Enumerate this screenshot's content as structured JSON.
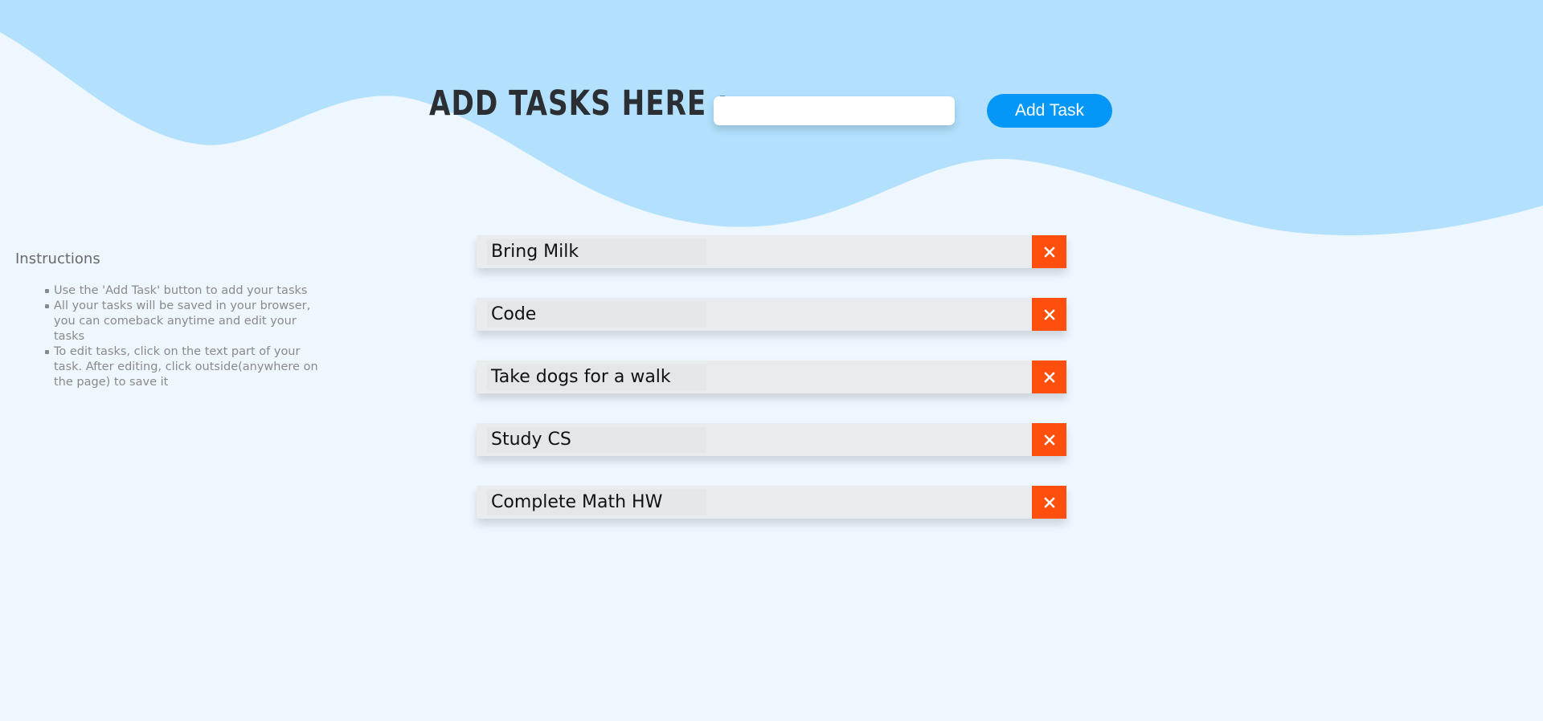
{
  "colors": {
    "background": "#eef6fe",
    "wave": "#b2e0fd",
    "accent_button": "#0597f7",
    "delete_button": "#ff4f0f",
    "task_background": "#e8ecef"
  },
  "header": {
    "title": "ADD TASKS HERE :",
    "input_value": "",
    "input_placeholder": "",
    "add_button_label": "Add Task"
  },
  "instructions": {
    "title": "Instructions",
    "items": [
      "Use the 'Add Task' button to add your tasks",
      "All your tasks will be saved in your browser, you can comeback anytime and edit your tasks",
      "To edit tasks, click on the text part of your task. After editing, click outside(anywhere on the page) to save it"
    ]
  },
  "tasks": [
    {
      "text": "Bring Milk",
      "delete_icon": "close-icon"
    },
    {
      "text": "Code",
      "delete_icon": "close-icon"
    },
    {
      "text": "Take dogs for a walk",
      "delete_icon": "close-icon"
    },
    {
      "text": "Study CS",
      "delete_icon": "close-icon"
    },
    {
      "text": "Complete Math HW",
      "delete_icon": "close-icon"
    }
  ]
}
